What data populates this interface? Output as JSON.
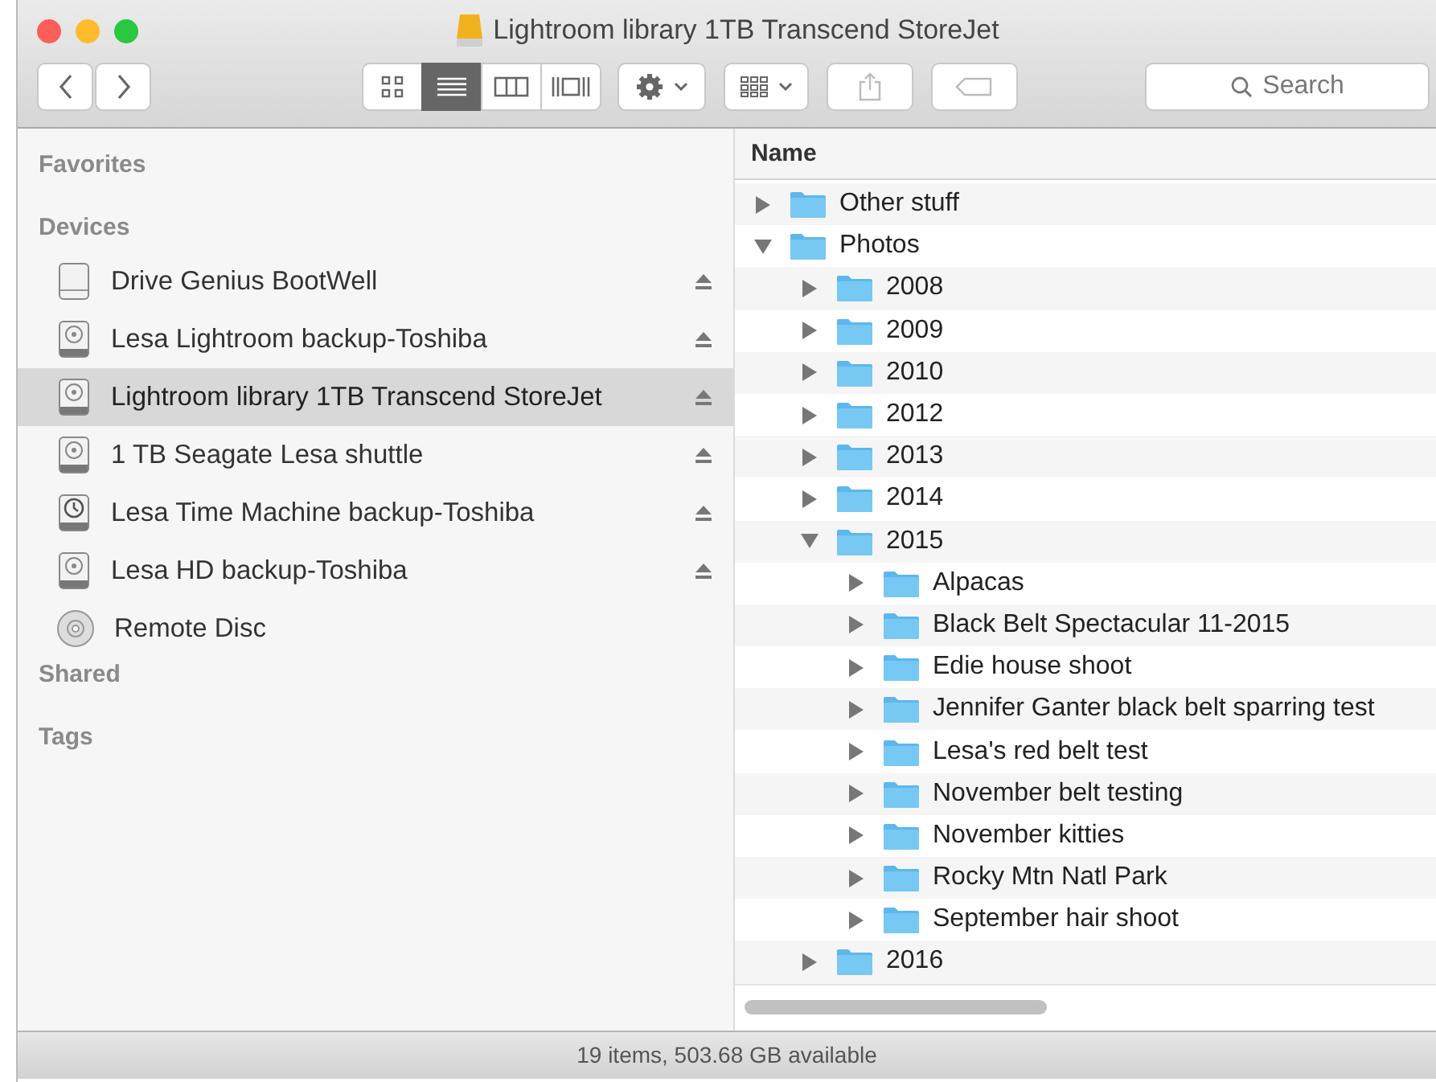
{
  "window": {
    "title": "Lightroom library 1TB Transcend StoreJet"
  },
  "toolbar": {
    "views": [
      {
        "kind": "icons",
        "selected": false
      },
      {
        "kind": "list",
        "selected": true
      },
      {
        "kind": "columns",
        "selected": false
      },
      {
        "kind": "coverflow",
        "selected": false
      }
    ],
    "search": {
      "placeholder": "Search"
    }
  },
  "sidebar": {
    "sections": [
      {
        "heading": "Favorites"
      },
      {
        "heading": "Devices",
        "items": [
          {
            "label": "Drive Genius BootWell",
            "kind": "drive",
            "eject": true,
            "selected": false
          },
          {
            "label": "Lesa Lightroom backup-Toshiba",
            "kind": "disk",
            "eject": true,
            "selected": false
          },
          {
            "label": "Lightroom library 1TB Transcend StoreJet",
            "kind": "disk",
            "eject": true,
            "selected": true
          },
          {
            "label": "1 TB Seagate Lesa shuttle",
            "kind": "disk",
            "eject": true,
            "selected": false
          },
          {
            "label": "Lesa Time Machine backup-Toshiba",
            "kind": "timemachine",
            "eject": true,
            "selected": false
          },
          {
            "label": "Lesa HD backup-Toshiba",
            "kind": "disk",
            "eject": true,
            "selected": false
          },
          {
            "label": "Remote Disc",
            "kind": "disc",
            "eject": false,
            "selected": false
          }
        ]
      },
      {
        "heading": "Shared"
      },
      {
        "heading": "Tags"
      }
    ]
  },
  "list": {
    "columns": [
      "Name"
    ],
    "rows": [
      {
        "name": "Other stuff",
        "expanded": false
      },
      {
        "name": "Photos",
        "expanded": true,
        "children": [
          {
            "name": "2008",
            "expanded": false
          },
          {
            "name": "2009",
            "expanded": false
          },
          {
            "name": "2010",
            "expanded": false
          },
          {
            "name": "2012",
            "expanded": false
          },
          {
            "name": "2013",
            "expanded": false
          },
          {
            "name": "2014",
            "expanded": false
          },
          {
            "name": "2015",
            "expanded": true,
            "children": [
              {
                "name": "Alpacas",
                "expanded": false
              },
              {
                "name": "Black Belt Spectacular 11-2015",
                "expanded": false
              },
              {
                "name": "Edie house shoot",
                "expanded": false
              },
              {
                "name": "Jennifer Ganter black belt sparring test",
                "expanded": false
              },
              {
                "name": "Lesa's red belt test",
                "expanded": false
              },
              {
                "name": "November belt testing",
                "expanded": false
              },
              {
                "name": "November kitties",
                "expanded": false
              },
              {
                "name": "Rocky Mtn Natl Park",
                "expanded": false
              },
              {
                "name": "September hair shoot",
                "expanded": false
              }
            ]
          },
          {
            "name": "2016",
            "expanded": false
          }
        ]
      }
    ]
  },
  "status_bar": "19 items, 503.68 GB available"
}
